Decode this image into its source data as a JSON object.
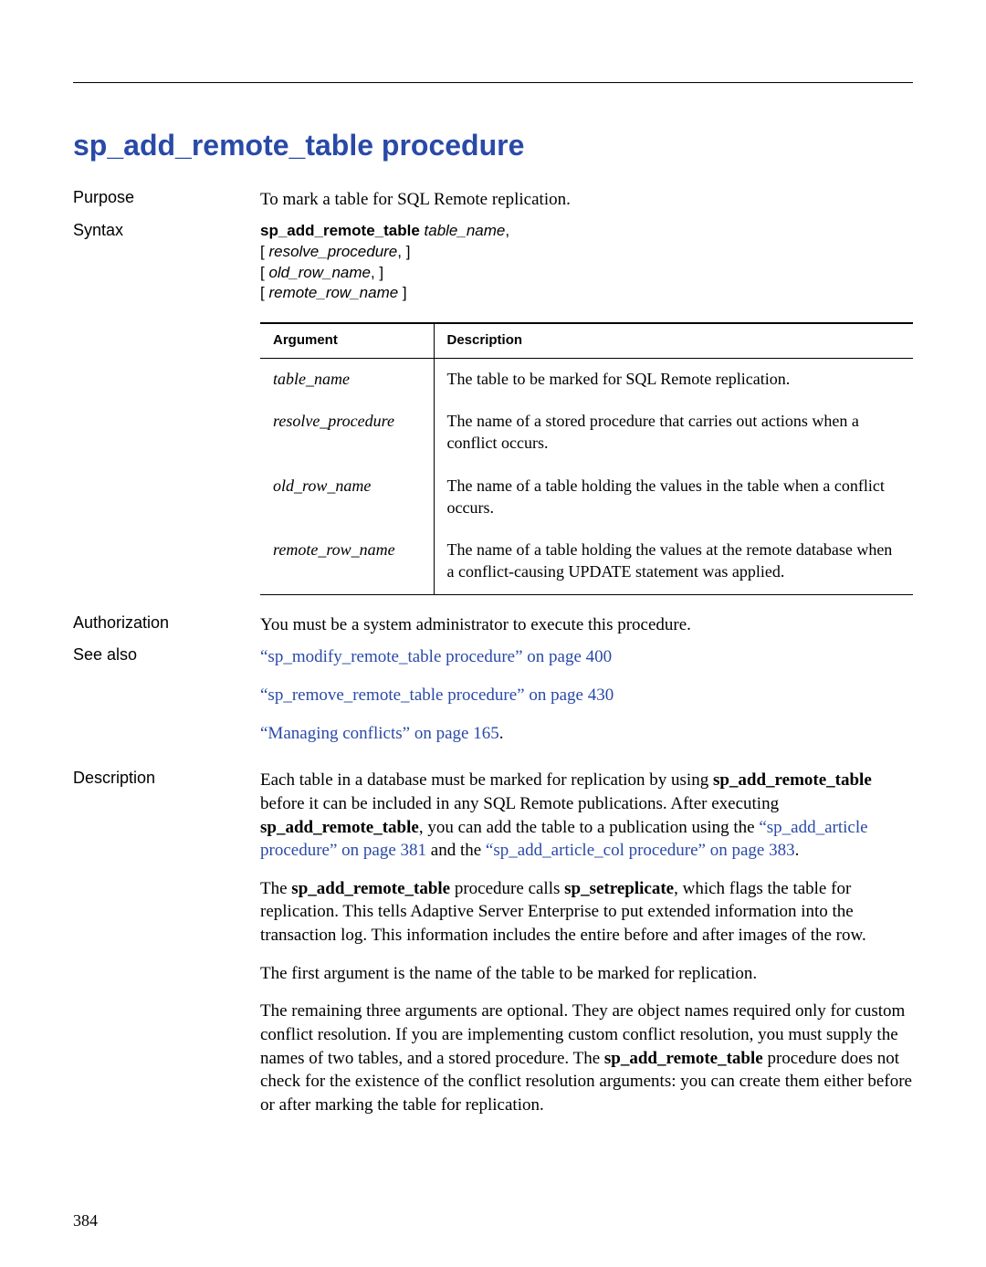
{
  "title": "sp_add_remote_table procedure",
  "sections": {
    "purpose": {
      "label": "Purpose",
      "text": "To mark a table for SQL Remote replication."
    },
    "syntax": {
      "label": "Syntax",
      "bold": "sp_add_remote_table",
      "arg0": " table_name",
      "comma": ",",
      "line1_open": "[ ",
      "line1_arg": "resolve_procedure",
      "line1_close": ", ]",
      "line2_open": "[ ",
      "line2_arg": "old_row_name",
      "line2_close": ", ]",
      "line3_open": "[ ",
      "line3_arg": "remote_row_name",
      "line3_close": " ]"
    },
    "args_table": {
      "headers": {
        "c1": "Argument",
        "c2": "Description"
      },
      "rows": [
        {
          "arg": "table_name",
          "desc": "The table to be marked for SQL Remote replication."
        },
        {
          "arg": "resolve_procedure",
          "desc": "The name of a stored procedure that carries out actions when a conflict occurs."
        },
        {
          "arg": "old_row_name",
          "desc": "The name of a table holding the values in the table when a conflict occurs."
        },
        {
          "arg": "remote_row_name",
          "desc": "The name of a table holding the values at the remote database when a conflict-causing UPDATE statement was applied."
        }
      ]
    },
    "authorization": {
      "label": "Authorization",
      "text": "You must be a system administrator to execute this procedure."
    },
    "see_also": {
      "label": "See also",
      "links": [
        "“sp_modify_remote_table procedure” on page 400",
        "“sp_remove_remote_table procedure” on page 430",
        "“Managing conflicts” on page 165"
      ],
      "period": "."
    },
    "description": {
      "label": "Description",
      "p1_a": "Each table in a database must be marked for replication by using ",
      "p1_bold1": "sp_add_remote_table",
      "p1_b": " before it can be included in any SQL Remote publications. After executing ",
      "p1_bold2": "sp_add_remote_table",
      "p1_c": ", you can add the table to a publication using the ",
      "p1_link1": "“sp_add_article procedure” on page 381",
      "p1_d": " and the ",
      "p1_link2": "“sp_add_article_col procedure” on page 383",
      "p1_e": ".",
      "p2_a": "The ",
      "p2_bold1": "sp_add_remote_table",
      "p2_b": " procedure calls ",
      "p2_bold2": "sp_setreplicate",
      "p2_c": ", which flags the table for replication. This tells Adaptive Server Enterprise to put extended information into the transaction log. This information includes the entire before and after images of the row.",
      "p3": "The first argument is the name of the table to be marked for replication.",
      "p4_a": "The remaining three arguments are optional. They are object names required only for custom conflict resolution. If you are implementing custom conflict resolution, you must supply the names of two tables, and a stored procedure. The ",
      "p4_bold": "sp_add_remote_table",
      "p4_b": " procedure does not check for the existence of the conflict resolution arguments: you can create them either before or after marking the table for replication."
    }
  },
  "page_number": "384"
}
